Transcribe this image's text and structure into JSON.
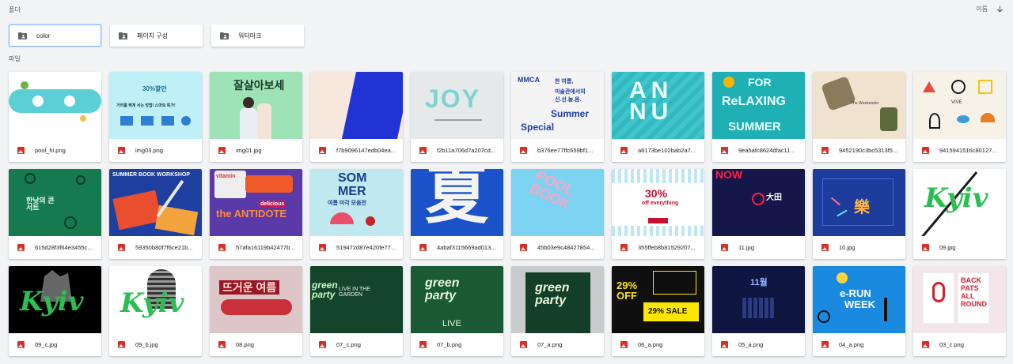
{
  "sections": {
    "folders": "폴더",
    "files": "파일"
  },
  "sort": {
    "label": "이름"
  },
  "folders": [
    {
      "name": "color"
    },
    {
      "name": "페이지 구성"
    },
    {
      "name": "워터마크"
    }
  ],
  "files": [
    {
      "name": "pool_hi.png"
    },
    {
      "name": "img03.png"
    },
    {
      "name": "img01.jpg"
    },
    {
      "name": "f7b9096147edb04ea..."
    },
    {
      "name": "f2b11a706d7a207cd..."
    },
    {
      "name": "b376ee77ffc659bf1..."
    },
    {
      "name": "a8173be102bab2a7..."
    },
    {
      "name": "9ea5afc8624dfac11..."
    },
    {
      "name": "9452190c3bc5313f5..."
    },
    {
      "name": "9415941516c80127..."
    },
    {
      "name": "615d28f3f64e3455c..."
    },
    {
      "name": "59350b80f7f6ce21b..."
    },
    {
      "name": "57afa16119b42477b..."
    },
    {
      "name": "519472d87e420fe77..."
    },
    {
      "name": "4abaf3115669ad013..."
    },
    {
      "name": "45b03e9c48427854..."
    },
    {
      "name": "355ffeb8b81529207..."
    },
    {
      "name": "11.jpg"
    },
    {
      "name": "10.jpg"
    },
    {
      "name": "09.jpg"
    },
    {
      "name": "09_c.jpg"
    },
    {
      "name": "09_b.jpg"
    },
    {
      "name": "08.png"
    },
    {
      "name": "07_c.png"
    },
    {
      "name": "07_b.png"
    },
    {
      "name": "07_a.png"
    },
    {
      "name": "06_a.png"
    },
    {
      "name": "05_a.png"
    },
    {
      "name": "04_a.png"
    },
    {
      "name": "03_c.png"
    }
  ],
  "thumb_text": {
    "img03_line1": "30%할인",
    "img03_line2": "거리를 뛰게 서는 방법! 스마트 특가!",
    "img01": "잘살아보세",
    "joy": "JOY",
    "mmca_1": "MMCA",
    "mmca_2": "한 여름,",
    "mmca_3": "미술관에서의",
    "mmca_4": "신.선.놀.음.",
    "mmca_5": "Summer",
    "mmca_6": "Special",
    "annu": "ANNU",
    "relax_1": "FOR",
    "relax_2": "ReLAXING",
    "relax_3": "SUMMER",
    "weekender": "The Weekender",
    "vive": "VIVE",
    "concert": "한낮의 콘서트",
    "book": "SUMMER BOOK WORKSHOP",
    "antidote_1": "vitamin",
    "antidote_2": "delicious",
    "antidote_3": "the ANTIDOTE",
    "sommer_1": "SOM",
    "sommer_2": "MER",
    "sommer_3": "여름 미각 모음전",
    "summer_cn": "夏",
    "pool_book": "POOL BOOK",
    "offer_1": "30%",
    "offer_2": "off everything",
    "now": "NOW",
    "daejeon": "大田",
    "yue": "樂",
    "kyiv": "Kyiv",
    "hot": "뜨거운 여름",
    "live_garden": "LIVE IN THE GARDEN",
    "green_party": "green party",
    "live": "LIVE",
    "sale_29": "29%",
    "sale_off": "OFF",
    "sale_29b": "29% SALE",
    "month": "11월",
    "erun_1": "e-RUN",
    "erun_2": "WEEK",
    "back_1": "BACK",
    "back_2": "PATS",
    "back_3": "ALL",
    "back_4": "ROUND"
  }
}
